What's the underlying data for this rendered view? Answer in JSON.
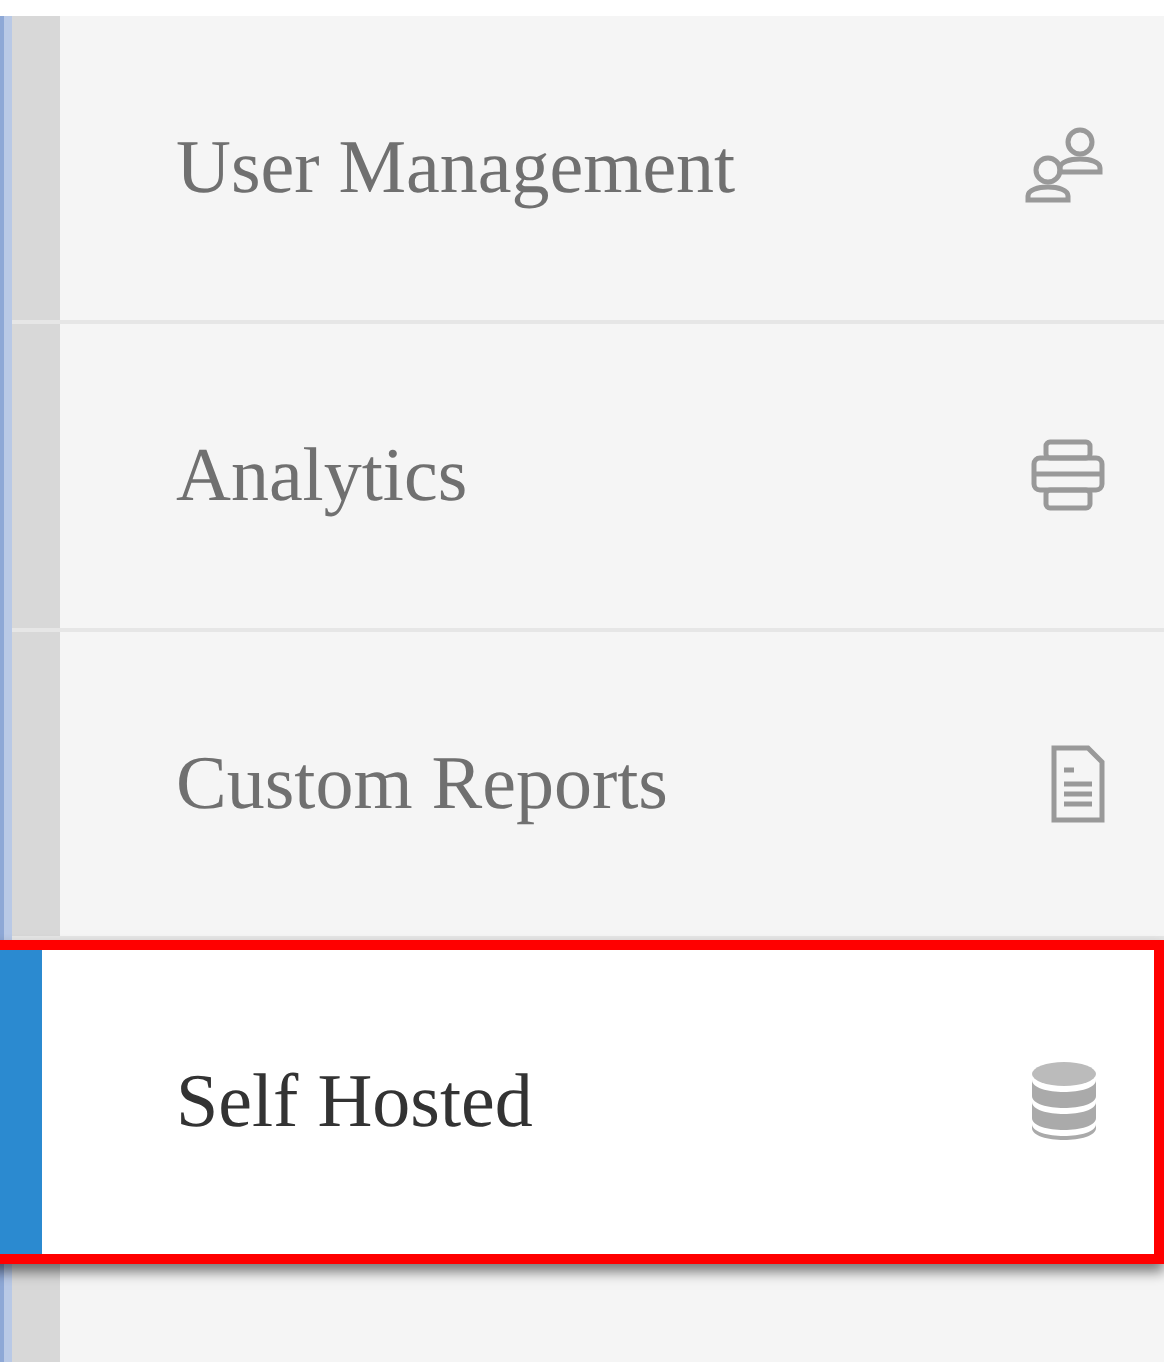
{
  "sidebar": {
    "items": [
      {
        "label": "User Management",
        "selected": false,
        "highlighted": false
      },
      {
        "label": "Analytics",
        "selected": false,
        "highlighted": false
      },
      {
        "label": "Custom Reports",
        "selected": false,
        "highlighted": false
      },
      {
        "label": "Self Hosted",
        "selected": true,
        "highlighted": true
      }
    ]
  }
}
